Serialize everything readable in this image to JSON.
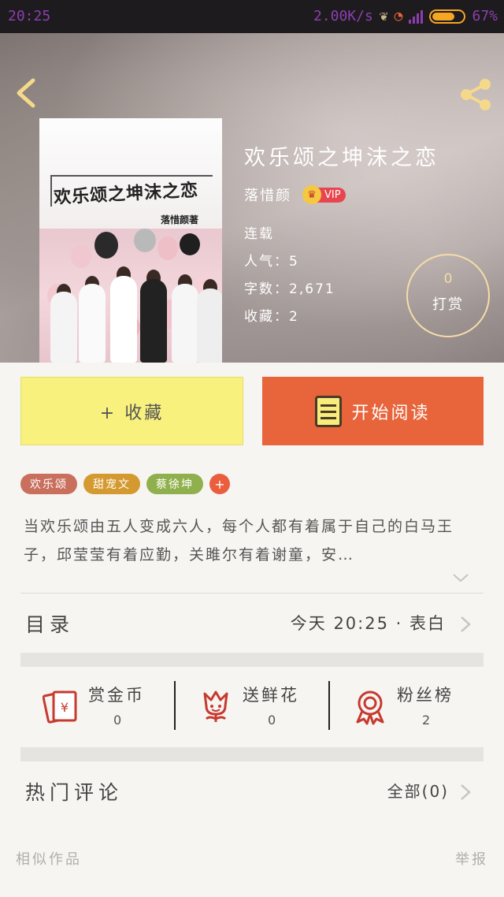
{
  "status": {
    "time": "20:25",
    "speed": "2.00K/s",
    "battery": "67%"
  },
  "book": {
    "cover_title": "欢乐颂之坤沫之恋",
    "cover_author": "落惜颜著",
    "title": "欢乐颂之坤沫之恋",
    "author": "落惜颜",
    "vip": "VIP",
    "status": "连载",
    "popularity": "人气：5",
    "word_count": "字数：2,671",
    "favorites": "收藏：2"
  },
  "reward": {
    "count": "0",
    "label": "打赏"
  },
  "actions": {
    "collect": "+ 收藏",
    "read": "开始阅读"
  },
  "tags": [
    {
      "label": "欢乐颂",
      "color": "#c96f5d"
    },
    {
      "label": "甜宠文",
      "color": "#d49a2f"
    },
    {
      "label": "蔡徐坤",
      "color": "#8fb04c"
    }
  ],
  "tag_add": "+",
  "description": "当欢乐颂由五人变成六人，每个人都有着属于自己的白马王子，邱莹莹有着应勤，关雎尔有着谢童，安…",
  "toc": {
    "title": "目录",
    "latest": "今天 20:25 · 表白"
  },
  "stats": [
    {
      "label": "赏金币",
      "value": "0",
      "icon": "red-envelope-icon"
    },
    {
      "label": "送鲜花",
      "value": "0",
      "icon": "flower-icon"
    },
    {
      "label": "粉丝榜",
      "value": "2",
      "icon": "medal-icon"
    }
  ],
  "comments": {
    "title": "热门评论",
    "all": "全部(0)"
  },
  "footer": {
    "similar": "相似作品",
    "report": "举报"
  },
  "colors": {
    "accent": "#e8643a",
    "collect_bg": "#f8f17e",
    "icon_red": "#c63a2f"
  }
}
